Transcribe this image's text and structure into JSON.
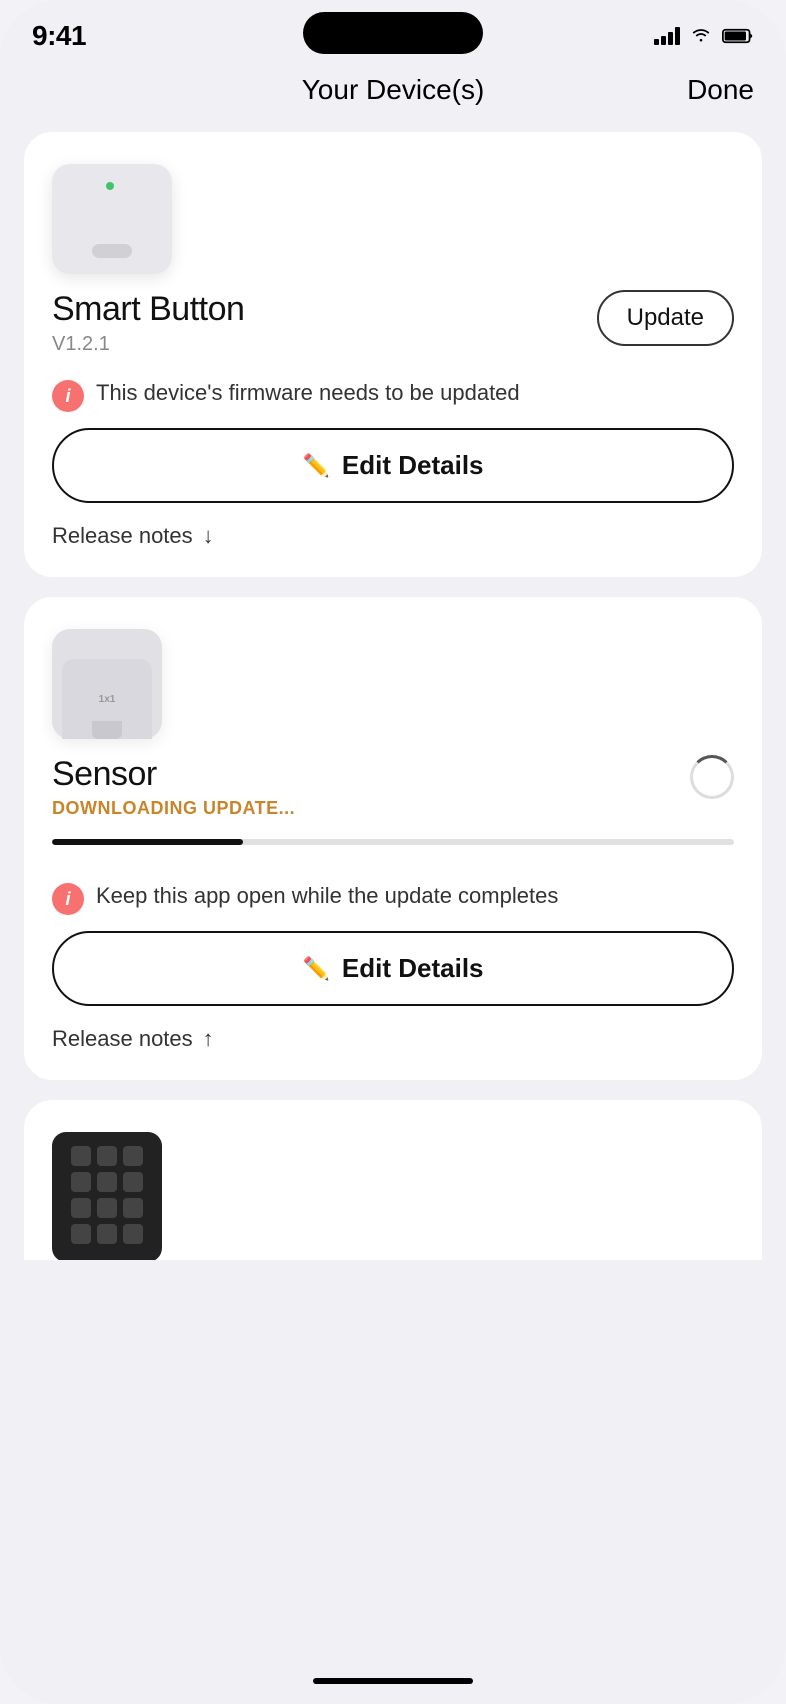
{
  "statusBar": {
    "time": "9:41"
  },
  "header": {
    "title": "Your Device(s)",
    "doneLabel": "Done"
  },
  "devices": [
    {
      "id": "smart-button",
      "name": "Smart Button",
      "version": "V1.2.1",
      "statusType": "update-needed",
      "warningText": "This device's firmware needs to be updated",
      "updateButtonLabel": "Update",
      "editDetailsLabel": "Edit Details",
      "releaseNotesLabel": "Release notes",
      "releaseNotesArrow": "↓",
      "progressPercent": 0
    },
    {
      "id": "sensor",
      "name": "Sensor",
      "version": "",
      "statusType": "downloading",
      "downloadingStatus": "DOWNLOADING UPDATE...",
      "warningText": "Keep this app open while the update completes",
      "editDetailsLabel": "Edit Details",
      "releaseNotesLabel": "Release notes",
      "releaseNotesArrow": "↑",
      "progressPercent": 28
    }
  ]
}
